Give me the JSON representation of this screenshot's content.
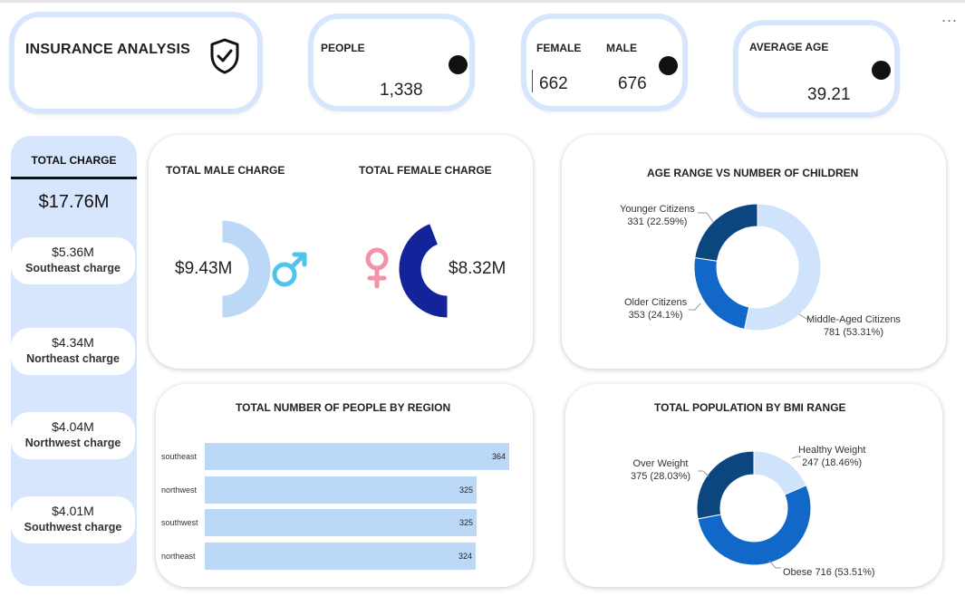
{
  "title": "INSURANCE ANALYSIS",
  "kpis": {
    "people_label": "PEOPLE",
    "people_value": "1,338",
    "female_label": "FEMALE",
    "female_value": "662",
    "male_label": "MALE",
    "male_value": "676",
    "avg_age_label": "AVERAGE AGE",
    "avg_age_value": "39.21"
  },
  "sidebar": {
    "header": "TOTAL CHARGE",
    "total": "$17.76M",
    "regions": [
      {
        "value": "$5.36M",
        "label": "Southeast charge"
      },
      {
        "value": "$4.34M",
        "label": "Northeast charge"
      },
      {
        "value": "$4.04M",
        "label": "Northwest charge"
      },
      {
        "value": "$4.01M",
        "label": "Southwest charge"
      }
    ]
  },
  "gender_charge": {
    "male_title": "TOTAL MALE CHARGE",
    "female_title": "TOTAL FEMALE CHARGE",
    "male_value": "$9.43M",
    "female_value": "$8.32M"
  },
  "colors": {
    "light": "#bcd8f7",
    "panel": "#d7e6fd",
    "donut_light": "#cfe3fb",
    "medium": "#1168c8",
    "dark": "#0c467f",
    "female_gauge": "#13249b",
    "male_symbol": "#4cc4ee",
    "female_symbol": "#f391a9"
  },
  "icons": [
    "shield-check-icon",
    "male-symbol-icon",
    "female-symbol-icon",
    "more-options-icon"
  ],
  "more_label": "...",
  "chart_data": [
    {
      "type": "pie",
      "title": "AGE RANGE VS NUMBER OF CHILDREN",
      "labels": [
        "Middle-Aged Citizens",
        "Older Citizens",
        "Younger Citizens"
      ],
      "values": [
        781,
        353,
        331
      ],
      "label_lines": [
        [
          "Middle-Aged Citizens",
          "781 (53.31%)"
        ],
        [
          "Older Citizens",
          "353 (24.1%)"
        ],
        [
          "Younger Citizens",
          "331 (22.59%)"
        ]
      ],
      "colors": [
        "#cfe3fb",
        "#1168c8",
        "#0c467f"
      ]
    },
    {
      "type": "bar",
      "title": "TOTAL NUMBER OF PEOPLE BY REGION",
      "categories": [
        "southeast",
        "northwest",
        "southwest",
        "northeast"
      ],
      "values": [
        364,
        325,
        325,
        324
      ],
      "orientation": "horizontal"
    },
    {
      "type": "pie",
      "title": "TOTAL POPULATION BY BMI RANGE",
      "labels": [
        "Healthy Weight",
        "Obese",
        "Over Weight"
      ],
      "values": [
        247,
        716,
        375
      ],
      "label_lines": [
        [
          "Healthy Weight",
          "247 (18.46%)"
        ],
        [
          "Obese 716 (53.51%)"
        ],
        [
          "Over Weight",
          "375 (28.03%)"
        ]
      ],
      "colors": [
        "#cfe3fb",
        "#1168c8",
        "#0c467f"
      ]
    },
    {
      "type": "pie",
      "title": "",
      "labels": [
        "TOTAL MALE CHARGE",
        "TOTAL FEMALE CHARGE"
      ],
      "values": [
        9.43,
        8.32
      ],
      "colors": [
        "#bcd8f7",
        "#13249b"
      ]
    }
  ]
}
